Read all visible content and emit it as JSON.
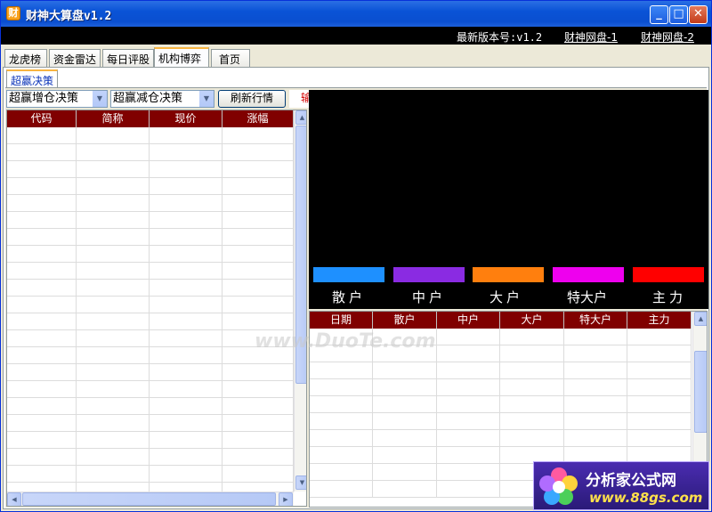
{
  "window": {
    "app_icon": "财",
    "title": "财神大算盘v1.2",
    "min_glyph": "_",
    "max_glyph": "□",
    "close_glyph": "✕"
  },
  "infobar": {
    "version_text": "最新版本号:v1.2",
    "link1": "财神网盘-1",
    "link2": "财神网盘-2"
  },
  "tabs": [
    "龙虎榜",
    "资金雷达",
    "每日评股",
    "机构博弈",
    "首页"
  ],
  "active_tab": "机构博弈",
  "subtab": "超赢决策",
  "toolbar": {
    "select1": "超赢增仓决策",
    "select2": "超赢减仓决策",
    "refresh_label": "刷新行情",
    "code_input": "输入代码"
  },
  "left_table": {
    "columns": [
      "代码",
      "简称",
      "现价",
      "涨幅"
    ],
    "rows": []
  },
  "chart_panel": {
    "bars": [
      {
        "label": "散户",
        "color": "#1e90ff"
      },
      {
        "label": "中户",
        "color": "#8a2be2"
      },
      {
        "label": "大户",
        "color": "#ff7f0e"
      },
      {
        "label": "特大户",
        "color": "#ee00ee"
      },
      {
        "label": "主力",
        "color": "#ff0000"
      }
    ]
  },
  "right_table": {
    "columns": [
      "日期",
      "散户",
      "中户",
      "大户",
      "特大户",
      "主力"
    ],
    "rows": []
  },
  "watermark": "www.DuoTe.com",
  "logo": {
    "name": "分析家公式网",
    "url": "www.88gs.com"
  }
}
